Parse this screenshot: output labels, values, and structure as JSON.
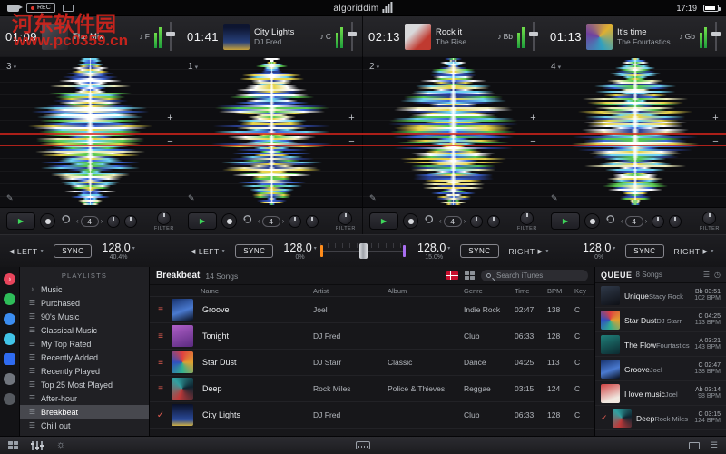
{
  "colors": {
    "accent_green": "#3ed65a",
    "marker_orange": "#ff8c1a",
    "marker_purple": "#a86ef0",
    "watermark_red": "#d4241c",
    "handle_red": "#e05b4f"
  },
  "waveform_palette": [
    "#3c66d8",
    "#6fd3f2",
    "#e8d44a",
    "#ffffff",
    "#58c94f",
    "#2a3f8f",
    "#f0eebc"
  ],
  "icons": {
    "play": "▶",
    "chevron_down": "▾",
    "plus": "+",
    "minus": "−",
    "pencil": "✎",
    "check": "✓",
    "note": "♪",
    "left_arrow": "◀",
    "right_arrow": "▶",
    "burger": "≡",
    "sun": "☼",
    "list": "☰",
    "clock": "◷",
    "prev": "‹",
    "next": "›"
  },
  "menubar": {
    "rec_label": "REC",
    "logo": "algoriddim",
    "time": "17:19"
  },
  "watermark": {
    "line1": "河东软件园",
    "line2": "www.pc0359.cn"
  },
  "decks": [
    {
      "time": "01:09",
      "title": "The Mix",
      "artist": "",
      "key": "F",
      "bar_label": "3",
      "bpm": "128.0",
      "percent": "40.4%"
    },
    {
      "time": "01:41",
      "title": "City Lights",
      "artist": "DJ Fred",
      "key": "C",
      "bar_label": "1",
      "bpm": "128.0",
      "percent": "0%"
    },
    {
      "time": "02:13",
      "title": "Rock it",
      "artist": "The Rise",
      "key": "Bb",
      "bar_label": "2",
      "bpm": "128.0",
      "percent": "15.0%"
    },
    {
      "time": "01:13",
      "title": "It's time",
      "artist": "The Fourtastics",
      "key": "Gb",
      "bar_label": "4",
      "bpm": "128.0",
      "percent": "0%"
    }
  ],
  "transport": {
    "loop_count": "4",
    "filter_label": "FILTER"
  },
  "mixer": {
    "sync": "SYNC",
    "left": "LEFT",
    "right": "RIGHT"
  },
  "playlists": {
    "header": "PLAYLISTS",
    "items": [
      {
        "label": "Music"
      },
      {
        "label": "Purchased"
      },
      {
        "label": "90's Music"
      },
      {
        "label": "Classical Music"
      },
      {
        "label": "My Top Rated"
      },
      {
        "label": "Recently Added"
      },
      {
        "label": "Recently Played"
      },
      {
        "label": "Top 25 Most Played"
      },
      {
        "label": "After-hour"
      },
      {
        "label": "Breakbeat",
        "selected": true
      },
      {
        "label": "Chill out"
      }
    ]
  },
  "library": {
    "title": "Breakbeat",
    "count": "14 Songs",
    "search_placeholder": "Search iTunes",
    "columns": [
      "Name",
      "Artist",
      "Album",
      "Genre",
      "Time",
      "BPM",
      "Key"
    ],
    "rows": [
      {
        "name": "Groove",
        "artist": "Joel",
        "album": "",
        "genre": "Indie Rock",
        "time": "02:47",
        "bpm": "138",
        "key": "C"
      },
      {
        "name": "Tonight",
        "artist": "DJ Fred",
        "album": "",
        "genre": "Club",
        "time": "06:33",
        "bpm": "128",
        "key": "C"
      },
      {
        "name": "Star Dust",
        "artist": "DJ Starr",
        "album": "Classic",
        "genre": "Dance",
        "time": "04:25",
        "bpm": "113",
        "key": "C"
      },
      {
        "name": "Deep",
        "artist": "Rock Miles",
        "album": "Police & Thieves",
        "genre": "Reggae",
        "time": "03:15",
        "bpm": "124",
        "key": "C"
      },
      {
        "name": "City Lights",
        "artist": "DJ Fred",
        "album": "",
        "genre": "Club",
        "time": "06:33",
        "bpm": "128",
        "key": "C"
      }
    ]
  },
  "queue": {
    "title": "QUEUE",
    "count": "8 Songs",
    "items": [
      {
        "title": "Unique",
        "artist": "Stacy Rock",
        "keytime": "Bb 03:51",
        "bpm": "102 BPM"
      },
      {
        "title": "Star Dust",
        "artist": "DJ Starr",
        "keytime": "C 04:25",
        "bpm": "113 BPM"
      },
      {
        "title": "The Flow",
        "artist": "Fourtastics",
        "keytime": "A 03:21",
        "bpm": "143 BPM"
      },
      {
        "title": "Groove",
        "artist": "Joel",
        "keytime": "C 02:47",
        "bpm": "138 BPM"
      },
      {
        "title": "I love music",
        "artist": "Joel",
        "keytime": "Ab 03:14",
        "bpm": "98 BPM"
      },
      {
        "title": "Deep",
        "artist": "Rock Miles",
        "keytime": "C 03:15",
        "bpm": "124 BPM"
      }
    ]
  }
}
